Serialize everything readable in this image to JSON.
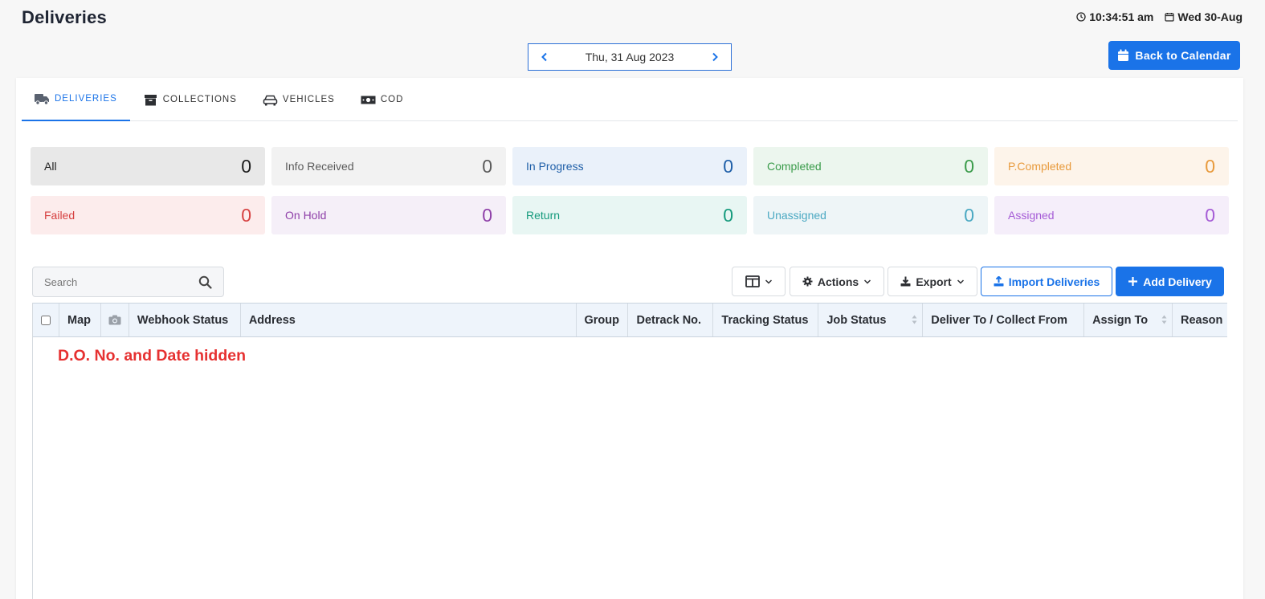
{
  "header": {
    "title": "Deliveries",
    "time": "10:34:51 am",
    "date": "Wed 30-Aug"
  },
  "date_nav": {
    "current": "Thu, 31 Aug 2023"
  },
  "back_button": {
    "label": "Back to Calendar"
  },
  "tabs": [
    {
      "label": "DELIVERIES",
      "icon": "truck-icon",
      "active": true
    },
    {
      "label": "COLLECTIONS",
      "icon": "archive-icon",
      "active": false
    },
    {
      "label": "VEHICLES",
      "icon": "car-icon",
      "active": false
    },
    {
      "label": "COD",
      "icon": "money-icon",
      "active": false
    }
  ],
  "stats": [
    {
      "label": "All",
      "value": "0",
      "bg": "#e8e8e8",
      "color": "#1b1b1b"
    },
    {
      "label": "Info Received",
      "value": "0",
      "bg": "#f2f2f2",
      "color": "#5a5a5a"
    },
    {
      "label": "In Progress",
      "value": "0",
      "bg": "#eaf1fa",
      "color": "#1f5fa8"
    },
    {
      "label": "Completed",
      "value": "0",
      "bg": "#ecf6ee",
      "color": "#3a9b4a"
    },
    {
      "label": "P.Completed",
      "value": "0",
      "bg": "#fdf4ea",
      "color": "#e89a3c"
    },
    {
      "label": "Failed",
      "value": "0",
      "bg": "#fcecec",
      "color": "#d64040"
    },
    {
      "label": "On Hold",
      "value": "0",
      "bg": "#f5eff8",
      "color": "#8e3fa8"
    },
    {
      "label": "Return",
      "value": "0",
      "bg": "#e8f6f3",
      "color": "#159a7c"
    },
    {
      "label": "Unassigned",
      "value": "0",
      "bg": "#eef5f7",
      "color": "#4aa8c2"
    },
    {
      "label": "Assigned",
      "value": "0",
      "bg": "#f5eefa",
      "color": "#a55bd6"
    }
  ],
  "search": {
    "placeholder": "Search"
  },
  "toolbar": {
    "actions_label": "Actions",
    "export_label": "Export",
    "import_label": "Import Deliveries",
    "add_label": "Add Delivery"
  },
  "table": {
    "columns": [
      "Map",
      "",
      "Webhook Status",
      "Address",
      "Group",
      "Detrack No.",
      "Tracking Status",
      "Job Status",
      "Deliver To / Collect From",
      "Assign To",
      "Reason"
    ]
  },
  "note": "D.O. No. and Date hidden",
  "colors": {
    "accent": "#1a73e8",
    "note": "#e63131"
  }
}
